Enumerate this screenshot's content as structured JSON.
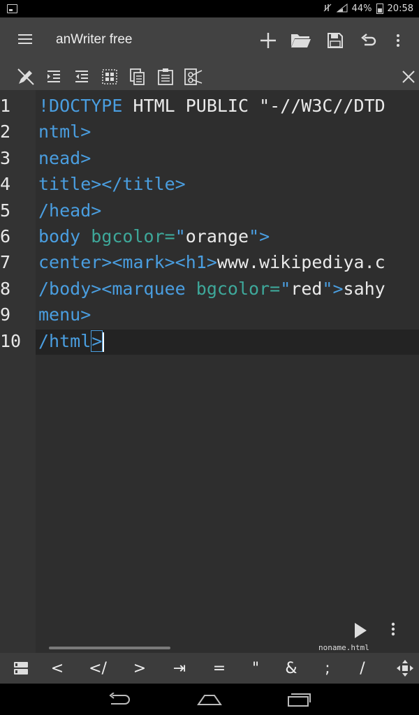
{
  "status": {
    "battery": "44%",
    "time": "20:58"
  },
  "app": {
    "title": "anWriter free"
  },
  "editor": {
    "line_numbers": [
      "1",
      "2",
      "3",
      "4",
      "5",
      "6",
      "7",
      "8",
      "9",
      "10"
    ],
    "lines": [
      [
        {
          "t": "tag",
          "v": "!DOCTYPE"
        },
        {
          "t": "str",
          "v": " HTML PUBLIC \"-//W3C//DTD"
        }
      ],
      [
        {
          "t": "tag",
          "v": "ntml>"
        }
      ],
      [
        {
          "t": "tag",
          "v": "nead>"
        }
      ],
      [
        {
          "t": "tag",
          "v": "title></title>"
        }
      ],
      [
        {
          "t": "tag",
          "v": "/head>"
        }
      ],
      [
        {
          "t": "tag",
          "v": "body "
        },
        {
          "t": "attr",
          "v": "bgcolor="
        },
        {
          "t": "tag",
          "v": "\""
        },
        {
          "t": "str",
          "v": "orange"
        },
        {
          "t": "tag",
          "v": "\">"
        }
      ],
      [
        {
          "t": "tag",
          "v": "center><mark><h1>"
        },
        {
          "t": "str",
          "v": "www.wikipediya.c"
        }
      ],
      [
        {
          "t": "tag",
          "v": "/body><marquee "
        },
        {
          "t": "attr",
          "v": "bgcolor="
        },
        {
          "t": "tag",
          "v": "\""
        },
        {
          "t": "str",
          "v": "red"
        },
        {
          "t": "tag",
          "v": "\">"
        },
        {
          "t": "str",
          "v": "sahy"
        }
      ],
      [
        {
          "t": "tag",
          "v": "menu>"
        }
      ],
      [
        {
          "t": "tag",
          "v": "/html"
        },
        {
          "t": "box",
          "v": ">"
        }
      ]
    ],
    "filename": "noname.html"
  },
  "keys": [
    "<",
    "</",
    ">",
    "⇥",
    "=",
    "\"",
    "&",
    ";",
    "/"
  ],
  "icons": {
    "appbar": [
      "menu-icon",
      "add-icon",
      "open-folder-icon",
      "save-icon",
      "undo-icon",
      "more-vert-icon"
    ],
    "toolbar": [
      "edit-icon",
      "indent-icon",
      "outdent-icon",
      "select-all-icon",
      "copy-icon",
      "paste-icon",
      "cut-icon",
      "close-icon"
    ]
  }
}
